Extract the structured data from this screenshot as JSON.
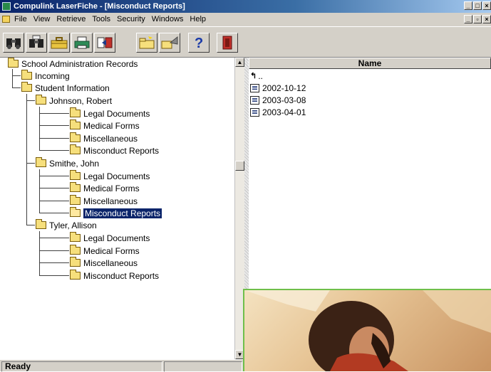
{
  "window": {
    "title": "Compulink LaserFiche - [Misconduct Reports]"
  },
  "menu": [
    "File",
    "View",
    "Retrieve",
    "Tools",
    "Security",
    "Windows",
    "Help"
  ],
  "toolbar": [
    "binoculars-icon",
    "search-icon",
    "briefcase-icon",
    "print-icon",
    "export-icon",
    "new-folder-icon",
    "import-icon",
    "help-icon",
    "exit-icon"
  ],
  "tree": {
    "root": "School Administration Records",
    "incoming": "Incoming",
    "student_info": "Student Information",
    "students": [
      {
        "name": "Johnson, Robert",
        "folders": [
          "Legal Documents",
          "Medical Forms",
          "Miscellaneous",
          "Misconduct Reports"
        ]
      },
      {
        "name": "Smithe, John",
        "folders": [
          "Legal Documents",
          "Medical Forms",
          "Miscellaneous",
          "Misconduct Reports"
        ]
      },
      {
        "name": "Tyler, Allison",
        "folders": [
          "Legal Documents",
          "Medical Forms",
          "Miscellaneous",
          "Misconduct Reports"
        ]
      }
    ]
  },
  "list": {
    "header": "Name",
    "up": "..",
    "items": [
      "2002-10-12",
      "2003-03-08",
      "2003-04-01"
    ]
  },
  "status": {
    "text": "Ready"
  }
}
